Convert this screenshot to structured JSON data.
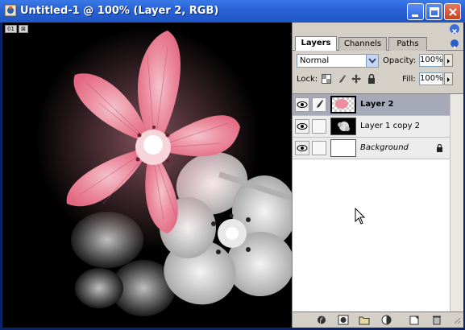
{
  "window": {
    "title": "Untitled-1 @ 100% (Layer 2, RGB)",
    "controls": [
      "minimize-icon",
      "maximize-icon",
      "close-icon"
    ]
  },
  "canvas": {
    "mini_tabs": [
      "01",
      "⊠"
    ]
  },
  "layers_panel": {
    "tabs": [
      {
        "label": "Layers",
        "active": true
      },
      {
        "label": "Channels",
        "active": false
      },
      {
        "label": "Paths",
        "active": false
      }
    ],
    "blend_mode": "Normal",
    "opacity_label": "Opacity:",
    "opacity_value": "100%",
    "lock_label": "Lock:",
    "fill_label": "Fill:",
    "fill_value": "100%",
    "layers": [
      {
        "name": "Layer 2",
        "selected": true,
        "visible": true,
        "bold": true,
        "italic": false,
        "locked": false
      },
      {
        "name": "Layer 1 copy 2",
        "selected": false,
        "visible": true,
        "bold": false,
        "italic": false,
        "locked": false
      },
      {
        "name": "Background",
        "selected": false,
        "visible": true,
        "bold": false,
        "italic": true,
        "locked": true
      }
    ],
    "footer_icons": [
      "layer-style-icon",
      "mask-icon",
      "new-set-icon",
      "adjustment-layer-icon",
      "new-layer-icon",
      "trash-icon"
    ]
  },
  "colors": {
    "title_bar": "#2a63d6",
    "panel_bg": "#d4d0c8",
    "selected_row": "#a6aab8",
    "flower_pink": "#e8788f"
  }
}
